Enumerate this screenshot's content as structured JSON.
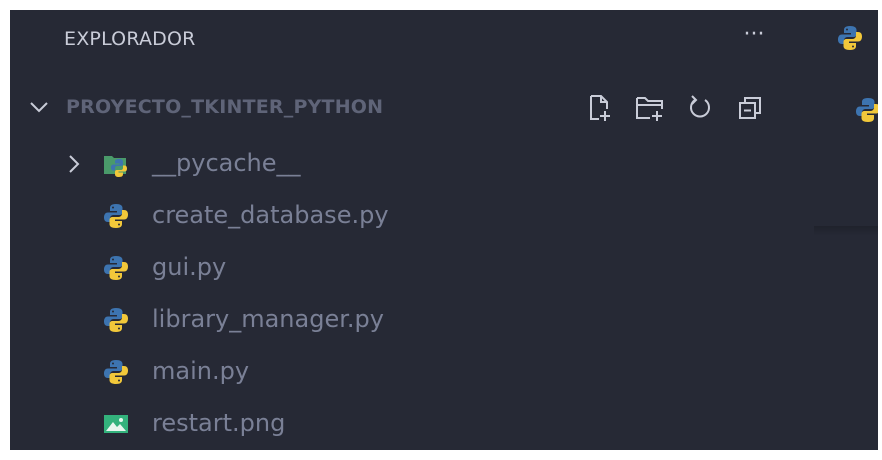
{
  "explorer": {
    "title": "EXPLORADOR",
    "more_label": "···"
  },
  "project": {
    "name": "PROYECTO_TKINTER_PYTHON",
    "expanded": true,
    "toolbar": {
      "icons": [
        "new-file-icon",
        "new-folder-icon",
        "refresh-icon",
        "collapse-all-icon"
      ]
    }
  },
  "files": [
    {
      "name": "__pycache__",
      "type": "folder",
      "icon": "python-folder-icon",
      "collapsed": true
    },
    {
      "name": "create_database.py",
      "type": "python",
      "icon": "python-file-icon"
    },
    {
      "name": "gui.py",
      "type": "python",
      "icon": "python-file-icon"
    },
    {
      "name": "library_manager.py",
      "type": "python",
      "icon": "python-file-icon"
    },
    {
      "name": "main.py",
      "type": "python",
      "icon": "python-file-icon"
    },
    {
      "name": "restart.png",
      "type": "image",
      "icon": "image-file-icon"
    }
  ],
  "colors": {
    "background": "#262935",
    "header_text": "#c9ccd8",
    "project_text": "#5f6478",
    "file_text": "#7a8096",
    "python_blue": "#3d74b0",
    "python_yellow": "#f2c83a",
    "image_green": "#33b27c"
  }
}
